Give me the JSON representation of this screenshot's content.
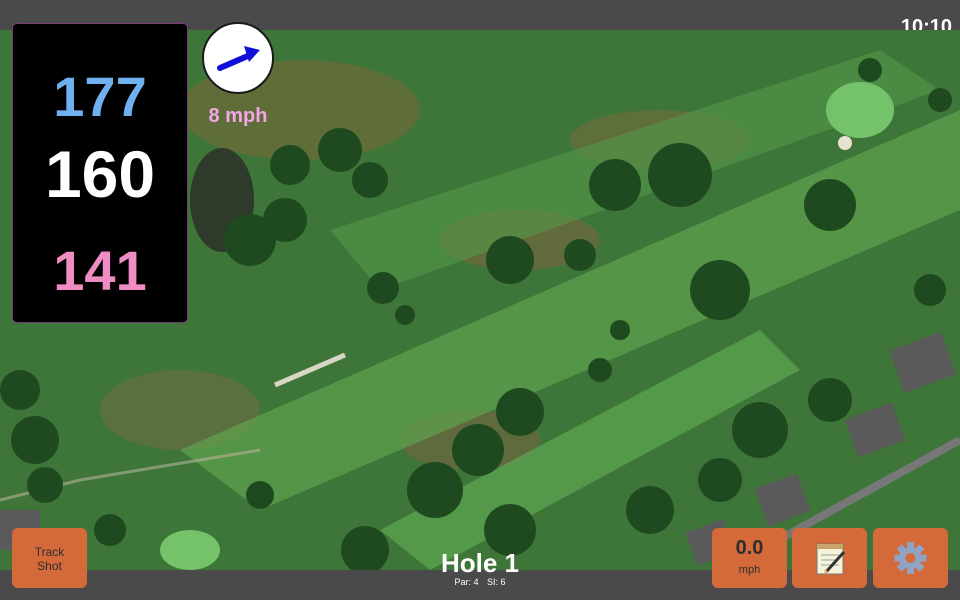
{
  "status": {
    "time": "10:10"
  },
  "distances": {
    "back": "177",
    "middle": "160",
    "front": "141"
  },
  "wind": {
    "speed_label": "8 mph",
    "arrow_icon": "arrow-right-icon"
  },
  "hole": {
    "title": "Hole 1",
    "par": "Par: 4",
    "stroke_index": "SI: 6"
  },
  "buttons": {
    "track_shot_line1": "Track",
    "track_shot_line2": "Shot",
    "wind_value": "0.0",
    "wind_unit": "mph",
    "notes_icon": "notepad-icon",
    "settings_icon": "gear-icon"
  },
  "colors": {
    "back": "#6fb0f0",
    "middle": "#ffffff",
    "front": "#f08cc4",
    "button": "#d4693a"
  }
}
